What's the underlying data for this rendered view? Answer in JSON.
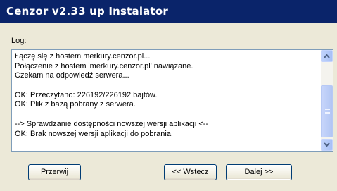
{
  "window": {
    "title": "Cenzor v2.33 up Instalator"
  },
  "log": {
    "label": "Log:",
    "lines": [
      "Łączę się z hostem merkury.cenzor.pl...",
      "Połączenie z hostem 'merkury.cenzor.pl' nawiązane.",
      "Czekam na odpowiedź serwera...",
      "",
      "OK: Przeczytano: 226192/226192 bajtów.",
      "OK: Plik z bazą pobrany z serwera.",
      "",
      "--> Sprawdzanie dostępności nowszej wersji aplikacji <--",
      "OK: Brak nowszej wersji aplikacji do pobrania."
    ]
  },
  "buttons": {
    "stop": "Przerwij",
    "back": "<< Wstecz",
    "next": "Dalej >>"
  },
  "colors": {
    "titlebar": "#0a246a",
    "face": "#ece9d8",
    "field_border": "#7f9db9"
  }
}
